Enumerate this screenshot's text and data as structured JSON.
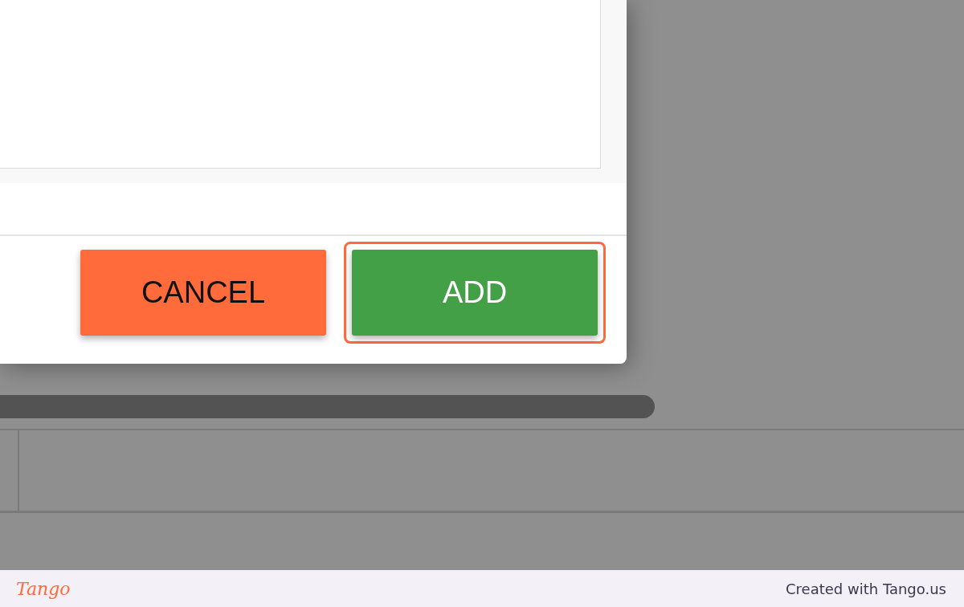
{
  "dialog": {
    "text_area": {
      "kind": "textarea"
    },
    "buttons": [
      {
        "label": "CANCEL",
        "kind": "cancel",
        "highlighted": false
      },
      {
        "label": "ADD",
        "kind": "primary",
        "highlighted": true
      }
    ]
  },
  "footer": {
    "logo": "Tango",
    "credit": "Created with Tango.us"
  }
}
